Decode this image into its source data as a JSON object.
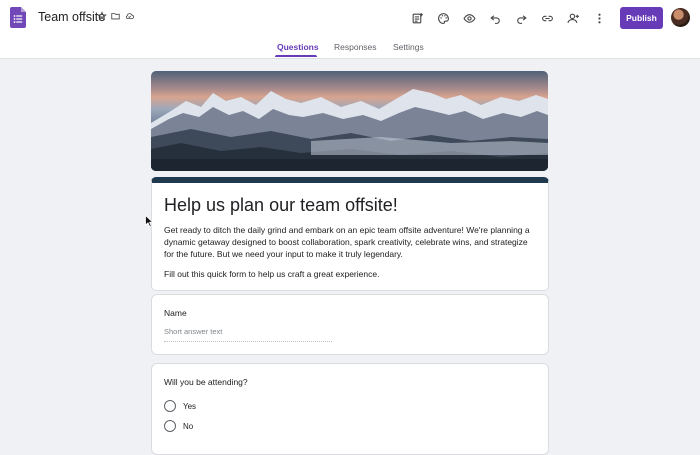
{
  "app": {
    "title": "Team offsite",
    "publish_label": "Publish"
  },
  "toolbar": {
    "icons": [
      "customize-addon-icon",
      "palette-icon",
      "preview-eye-icon",
      "undo-icon",
      "redo-icon",
      "link-icon",
      "add-collaborator-icon",
      "more-vert-icon"
    ]
  },
  "tabs": [
    {
      "label": "Questions",
      "active": true
    },
    {
      "label": "Responses",
      "active": false
    },
    {
      "label": "Settings",
      "active": false
    }
  ],
  "form": {
    "title": "Help us plan our team offsite!",
    "description": "Get ready to ditch the daily grind and embark on an epic team offsite adventure! We're planning a dynamic getaway designed to boost collaboration, spark creativity, celebrate wins, and strategize for the future. But we need your input to make it truly legendary.",
    "note": "Fill out this quick form to help us craft a great experience.",
    "accent_color": "#1f3a4f"
  },
  "questions": [
    {
      "title": "Name",
      "placeholder": "Short answer text"
    },
    {
      "title": "Will you be attending?",
      "options": [
        "Yes",
        "No"
      ]
    }
  ],
  "colors": {
    "brand": "#673ab7",
    "background": "#f0f1f4"
  }
}
